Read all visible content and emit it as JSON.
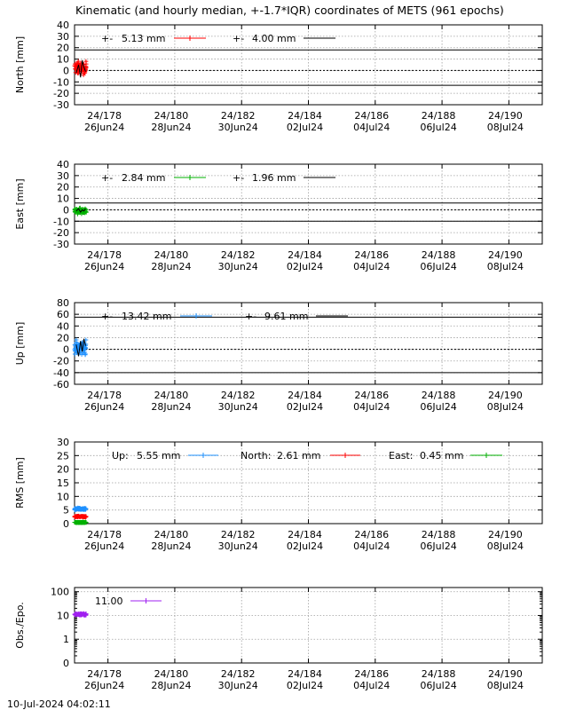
{
  "title": "Kinematic (and hourly median, +-1.7*IQR) coordinates of METS (961 epochs)",
  "timestamp": "10-Jul-2024 04:02:11",
  "colors": {
    "north": "#ff0000",
    "east": "#00b000",
    "up": "#1e90ff",
    "obs": "#a020f0",
    "median": "#000000",
    "grid": "#a0a0a0"
  },
  "x_axis": {
    "range": [
      177,
      191
    ],
    "ticks": [
      {
        "v": 178,
        "top": "24/178",
        "bottom": "26Jun24"
      },
      {
        "v": 180,
        "top": "24/180",
        "bottom": "28Jun24"
      },
      {
        "v": 182,
        "top": "24/182",
        "bottom": "30Jun24"
      },
      {
        "v": 184,
        "top": "24/184",
        "bottom": "02Jul24"
      },
      {
        "v": 186,
        "top": "24/186",
        "bottom": "04Jul24"
      },
      {
        "v": 188,
        "top": "24/188",
        "bottom": "06Jul24"
      },
      {
        "v": 190,
        "top": "24/190",
        "bottom": "08Jul24"
      }
    ]
  },
  "chart_data": [
    {
      "type": "scatter",
      "ylabel": "North [mm]",
      "ylim": [
        -30,
        40
      ],
      "yticks": [
        -30,
        -20,
        -10,
        0,
        10,
        20,
        30,
        40
      ],
      "grid": true,
      "x_range": [
        177.0,
        177.35
      ],
      "bands": [
        18,
        -13
      ],
      "series": [
        {
          "legend_prefix": "+-",
          "legend_value": "5.13 mm",
          "color": "#ff0000",
          "center": 2,
          "spread": 9
        },
        {
          "legend_prefix": "+-",
          "legend_value": "4.00 mm",
          "color": "#000000",
          "median": [
            [
              177.05,
              -2
            ],
            [
              177.12,
              5
            ],
            [
              177.18,
              -6
            ],
            [
              177.23,
              9
            ],
            [
              177.28,
              3
            ],
            [
              177.33,
              -1
            ]
          ]
        }
      ]
    },
    {
      "type": "scatter",
      "ylabel": "East [mm]",
      "ylim": [
        -30,
        40
      ],
      "yticks": [
        -30,
        -20,
        -10,
        0,
        10,
        20,
        30,
        40
      ],
      "grid": true,
      "x_range": [
        177.0,
        177.35
      ],
      "bands": [
        6,
        -10
      ],
      "series": [
        {
          "legend_prefix": "+-",
          "legend_value": "2.84 mm",
          "color": "#00b000",
          "center": -1,
          "spread": 4
        },
        {
          "legend_prefix": "+-",
          "legend_value": "1.96 mm",
          "color": "#000000",
          "median": [
            [
              177.05,
              -1
            ],
            [
              177.12,
              1
            ],
            [
              177.18,
              -2
            ],
            [
              177.23,
              0
            ],
            [
              177.28,
              -1
            ],
            [
              177.33,
              1
            ]
          ]
        }
      ]
    },
    {
      "type": "scatter",
      "ylabel": "Up [mm]",
      "ylim": [
        -60,
        80
      ],
      "yticks": [
        -60,
        -40,
        -20,
        0,
        20,
        40,
        60,
        80
      ],
      "grid": true,
      "x_range": [
        177.0,
        177.35
      ],
      "bands": [
        55,
        -40
      ],
      "series": [
        {
          "legend_prefix": "+-",
          "legend_value": "13.42 mm",
          "color": "#1e90ff",
          "center": 4,
          "spread": 20
        },
        {
          "legend_prefix": "+-",
          "legend_value": "9.61 mm",
          "color": "#000000",
          "median": [
            [
              177.05,
              8
            ],
            [
              177.12,
              -12
            ],
            [
              177.18,
              14
            ],
            [
              177.23,
              -4
            ],
            [
              177.28,
              18
            ],
            [
              177.33,
              6
            ]
          ]
        }
      ]
    },
    {
      "type": "scatter",
      "ylabel": "RMS [mm]",
      "ylim": [
        0,
        30
      ],
      "yticks": [
        0,
        5,
        10,
        15,
        20,
        25,
        30
      ],
      "grid": true,
      "x_range": [
        177.0,
        177.35
      ],
      "series": [
        {
          "legend_prefix": "Up:",
          "legend_value": "5.55 mm",
          "color": "#1e90ff",
          "center": 5.4,
          "spread": 0.6
        },
        {
          "legend_prefix": "North:",
          "legend_value": "2.61 mm",
          "color": "#ff0000",
          "center": 2.6,
          "spread": 0.3
        },
        {
          "legend_prefix": "East:",
          "legend_value": "0.45 mm",
          "color": "#00b000",
          "center": 0.45,
          "spread": 0.2
        }
      ]
    },
    {
      "type": "scatter",
      "ylabel": "Obs./Epo.",
      "yscale": "log",
      "ylim": [
        0.1,
        150
      ],
      "yticks": [
        {
          "v": 0.1,
          "label": "0"
        },
        {
          "v": 1,
          "label": "1"
        },
        {
          "v": 10,
          "label": "10"
        },
        {
          "v": 100,
          "label": "100"
        }
      ],
      "grid": true,
      "x_range": [
        177.0,
        177.35
      ],
      "series": [
        {
          "legend_prefix": "",
          "legend_value": "11.00",
          "color": "#a020f0",
          "center": 11,
          "spread": 1.5
        }
      ]
    }
  ]
}
